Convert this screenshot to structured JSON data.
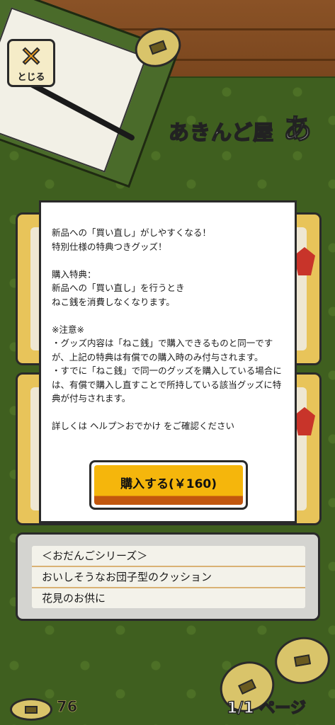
{
  "close_button": {
    "label": "とじる"
  },
  "shop": {
    "name": "あきんど屋"
  },
  "modal": {
    "lines": [
      "新品への「買い直し」がしやすくなる！",
      "特別仕様の特典つきグッズ！",
      "",
      "購入特典：",
      "新品への「買い直し」を行うとき",
      "ねこ銭を消費しなくなります。",
      "",
      "※注意※",
      "・グッズ内容は「ねこ銭」で購入できるものと同一ですが、上記の特典は有償での購入時のみ付与されます。",
      "・すでに「ねこ銭」で同一のグッズを購入している場合には、有償で購入し直すことで所持している該当グッズに特典が付与されます。",
      "",
      "詳しくは ヘルプ＞おでかけ をご確認ください"
    ],
    "buy_button": "購入する(￥160)"
  },
  "description": {
    "lines": [
      "＜おだんごシリーズ＞",
      "おいしそうなお団子型のクッション",
      "花見のお供に"
    ]
  },
  "footer": {
    "coin_count": "76",
    "page": "1/1 ページ"
  },
  "colors": {
    "button": "#f5b60c",
    "tatami": "#3f5f1f",
    "wood": "#8a5226"
  }
}
